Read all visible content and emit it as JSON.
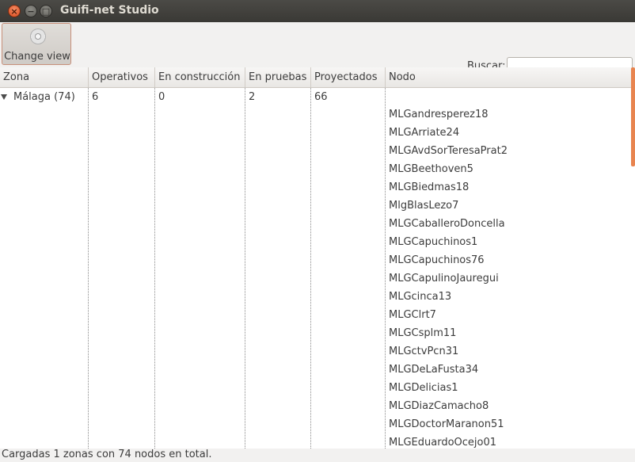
{
  "window": {
    "title": "Guifi-net Studio"
  },
  "toolbar": {
    "change_view_label": "Change view",
    "search_label": "Buscar:",
    "search_value": ""
  },
  "table": {
    "columns": [
      "Zona",
      "Operativos",
      "En construcción",
      "En pruebas",
      "Proyectados",
      "Nodo"
    ],
    "zone_row": {
      "zona": "Málaga (74)",
      "operativos": "6",
      "construccion": "0",
      "pruebas": "2",
      "proyectados": "66"
    },
    "nodes": [
      "MLGandresperez18",
      "MLGArriate24",
      "MLGAvdSorTeresaPrat2",
      "MLGBeethoven5",
      "MLGBiedmas18",
      "MlgBlasLezo7",
      "MLGCaballeroDoncella",
      "MLGCapuchinos1",
      "MLGCapuchinos76",
      "MLGCapulinoJauregui",
      "MLGcinca13",
      "MLGClrt7",
      "MLGCsplm11",
      "MLGctvPcn31",
      "MLGDeLaFusta34",
      "MLGDelicias1",
      "MLGDiazCamacho8",
      "MLGDoctorMaranon51",
      "MLGEduardoOcejo01"
    ]
  },
  "status": {
    "text": "Cargadas 1 zonas con 74 nodos en total."
  }
}
